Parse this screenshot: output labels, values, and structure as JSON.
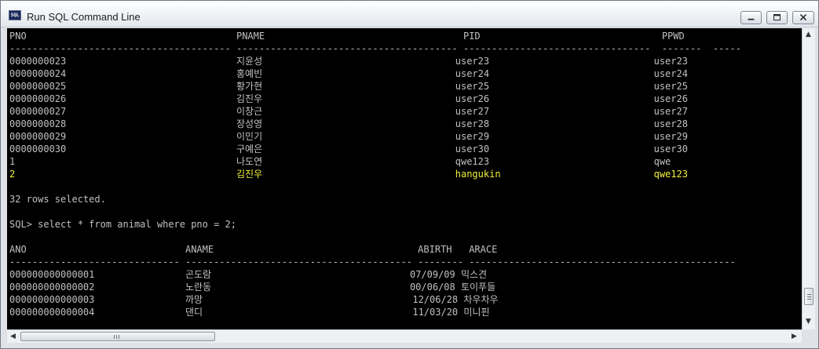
{
  "window": {
    "title": "Run SQL Command Line",
    "icon_text": "SQL"
  },
  "console": {
    "lines": [
      {
        "text": "PNO                                     PNAME                                   PID                                PPWD",
        "style": "normal"
      },
      {
        "text": "--------------------------------------- --------------------------------------- ---------------------------------  -------  -----",
        "style": "normal"
      },
      {
        "text": "0000000023                              지윤성                                  user23                             user23",
        "style": "normal"
      },
      {
        "text": "0000000024                              홍예빈                                  user24                             user24",
        "style": "normal"
      },
      {
        "text": "0000000025                              황가현                                  user25                             user25",
        "style": "normal"
      },
      {
        "text": "0000000026                              김진우                                  user26                             user26",
        "style": "normal"
      },
      {
        "text": "0000000027                              이창근                                  user27                             user27",
        "style": "normal"
      },
      {
        "text": "0000000028                              장성영                                  user28                             user28",
        "style": "normal"
      },
      {
        "text": "0000000029                              이민기                                  user29                             user29",
        "style": "normal"
      },
      {
        "text": "0000000030                              구예은                                  user30                             user30",
        "style": "normal"
      },
      {
        "text": "1                                       나도연                                  qwe123                             qwe",
        "style": "normal"
      },
      {
        "text": "2                                       김진우                                  hangukin                           qwe123",
        "style": "yellow"
      },
      {
        "text": "",
        "style": "normal"
      },
      {
        "text": "32 rows selected.",
        "style": "normal"
      },
      {
        "text": "",
        "style": "normal"
      },
      {
        "text": "SQL> select * from animal where pno = 2;",
        "style": "normal"
      },
      {
        "text": "",
        "style": "normal"
      },
      {
        "text": "ANO                            ANAME                                    ABIRTH   ARACE",
        "style": "normal"
      },
      {
        "text": "------------------------------ ---------------------------------------- -------- -----------------------------------------------",
        "style": "normal"
      },
      {
        "text": "000000000000001                곤도람                                   07/09/09 믹스견",
        "style": "normal"
      },
      {
        "text": "000000000000002                노란동                                   00/06/08 토이푸들",
        "style": "normal"
      },
      {
        "text": "000000000000003                까망                                     12/06/28 차우차우",
        "style": "normal"
      },
      {
        "text": "000000000000004                댄디                                     11/03/20 미니핀",
        "style": "normal"
      }
    ]
  },
  "colors": {
    "console_bg": "#000000",
    "console_text": "#c0c0c0",
    "highlight_text": "#f1f13a"
  }
}
